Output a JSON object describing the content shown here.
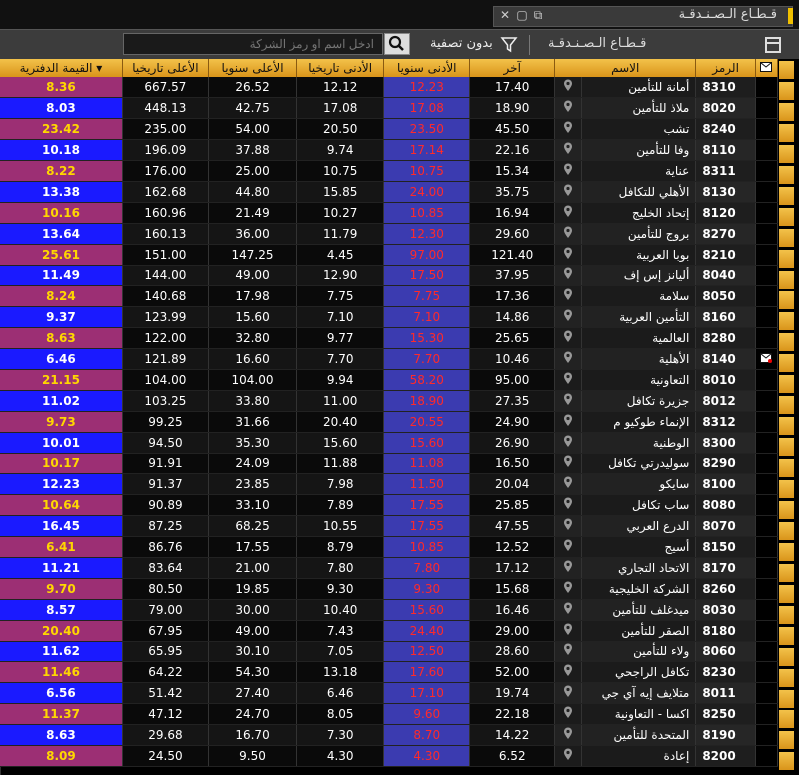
{
  "window": {
    "title": "قـطـاع الـصـنـدقـة"
  },
  "toolbar": {
    "sector_label": "قـطـاع الـصـنـدقـة",
    "filter_label": "بدون تصفية",
    "search_placeholder": "ادخل اسم او رمز الشركة"
  },
  "table": {
    "headers": {
      "symbol": "الرمز",
      "name": "الاسم",
      "last": "آخر",
      "low52": "الأدنى سنويا",
      "low_hist": "الأدنى تاريخيا",
      "high52": "الأعلى سنويا",
      "high_hist": "الأعلى تاريخيا",
      "book_value": "القيمة الدفترية"
    },
    "rows": [
      {
        "symbol": "8310",
        "name": "أمانة للتأمين",
        "last": "17.40",
        "low52": "12.23",
        "low_hist": "12.12",
        "high52": "26.52",
        "high_hist": "667.57",
        "bv": "8.36"
      },
      {
        "symbol": "8020",
        "name": "ملاذ للتأمين",
        "last": "18.90",
        "low52": "17.08",
        "low_hist": "17.08",
        "high52": "42.75",
        "high_hist": "448.13",
        "bv": "8.03"
      },
      {
        "symbol": "8240",
        "name": "تشب",
        "last": "45.50",
        "low52": "23.50",
        "low_hist": "20.50",
        "high52": "54.00",
        "high_hist": "235.00",
        "bv": "23.42"
      },
      {
        "symbol": "8110",
        "name": "وفا للتأمين",
        "last": "22.16",
        "low52": "17.14",
        "low_hist": "9.74",
        "high52": "37.88",
        "high_hist": "196.09",
        "bv": "10.18"
      },
      {
        "symbol": "8311",
        "name": "عناية",
        "last": "15.34",
        "low52": "10.75",
        "low_hist": "10.75",
        "high52": "25.00",
        "high_hist": "176.00",
        "bv": "8.22"
      },
      {
        "symbol": "8130",
        "name": "الأهلي للتكافل",
        "last": "35.75",
        "low52": "24.00",
        "low_hist": "15.85",
        "high52": "44.80",
        "high_hist": "162.68",
        "bv": "13.38"
      },
      {
        "symbol": "8120",
        "name": "إتحاد الخليج",
        "last": "16.94",
        "low52": "10.85",
        "low_hist": "10.27",
        "high52": "21.49",
        "high_hist": "160.96",
        "bv": "10.16"
      },
      {
        "symbol": "8270",
        "name": "بروج للتأمين",
        "last": "29.60",
        "low52": "12.30",
        "low_hist": "11.79",
        "high52": "36.00",
        "high_hist": "160.13",
        "bv": "13.64"
      },
      {
        "symbol": "8210",
        "name": "بوبا العربية",
        "last": "121.40",
        "low52": "97.00",
        "low_hist": "4.45",
        "high52": "147.25",
        "high_hist": "151.00",
        "bv": "25.61"
      },
      {
        "symbol": "8040",
        "name": "أليانز إس إف",
        "last": "37.95",
        "low52": "17.50",
        "low_hist": "12.90",
        "high52": "49.00",
        "high_hist": "144.00",
        "bv": "11.49"
      },
      {
        "symbol": "8050",
        "name": "سلامة",
        "last": "17.36",
        "low52": "7.75",
        "low_hist": "7.75",
        "high52": "17.98",
        "high_hist": "140.68",
        "bv": "8.24"
      },
      {
        "symbol": "8160",
        "name": "التأمين العربية",
        "last": "14.86",
        "low52": "7.10",
        "low_hist": "7.10",
        "high52": "15.60",
        "high_hist": "123.99",
        "bv": "9.37"
      },
      {
        "symbol": "8280",
        "name": "العالمية",
        "last": "25.65",
        "low52": "15.30",
        "low_hist": "9.77",
        "high52": "32.80",
        "high_hist": "122.00",
        "bv": "8.63"
      },
      {
        "symbol": "8140",
        "name": "الأهلية",
        "last": "10.46",
        "low52": "7.70",
        "low_hist": "7.70",
        "high52": "16.60",
        "high_hist": "121.89",
        "bv": "6.46"
      },
      {
        "symbol": "8010",
        "name": "التعاونية",
        "last": "95.00",
        "low52": "58.20",
        "low_hist": "9.94",
        "high52": "104.00",
        "high_hist": "104.00",
        "bv": "21.15"
      },
      {
        "symbol": "8012",
        "name": "جزيرة تكافل",
        "last": "27.35",
        "low52": "18.90",
        "low_hist": "11.00",
        "high52": "33.80",
        "high_hist": "103.25",
        "bv": "11.02"
      },
      {
        "symbol": "8312",
        "name": "الإنماء طوكيو م",
        "last": "24.90",
        "low52": "20.55",
        "low_hist": "20.40",
        "high52": "31.66",
        "high_hist": "99.25",
        "bv": "9.73"
      },
      {
        "symbol": "8300",
        "name": "الوطنية",
        "last": "26.90",
        "low52": "15.60",
        "low_hist": "15.60",
        "high52": "35.30",
        "high_hist": "94.50",
        "bv": "10.01"
      },
      {
        "symbol": "8290",
        "name": "سوليدرتي تكافل",
        "last": "16.50",
        "low52": "11.08",
        "low_hist": "11.88",
        "high52": "24.09",
        "high_hist": "91.91",
        "bv": "10.17"
      },
      {
        "symbol": "8100",
        "name": "سايكو",
        "last": "20.04",
        "low52": "11.50",
        "low_hist": "7.98",
        "high52": "23.85",
        "high_hist": "91.37",
        "bv": "12.23"
      },
      {
        "symbol": "8080",
        "name": "ساب تكافل",
        "last": "25.85",
        "low52": "17.55",
        "low_hist": "7.89",
        "high52": "33.10",
        "high_hist": "90.89",
        "bv": "10.64"
      },
      {
        "symbol": "8070",
        "name": "الدرع العربي",
        "last": "47.55",
        "low52": "17.55",
        "low_hist": "10.55",
        "high52": "68.25",
        "high_hist": "87.25",
        "bv": "16.45"
      },
      {
        "symbol": "8150",
        "name": "أسيج",
        "last": "12.52",
        "low52": "10.85",
        "low_hist": "8.79",
        "high52": "17.55",
        "high_hist": "86.76",
        "bv": "6.41"
      },
      {
        "symbol": "8170",
        "name": "الاتحاد التجاري",
        "last": "17.12",
        "low52": "7.80",
        "low_hist": "7.80",
        "high52": "21.00",
        "high_hist": "83.64",
        "bv": "11.21"
      },
      {
        "symbol": "8260",
        "name": "الشركة الخليجية",
        "last": "15.68",
        "low52": "9.30",
        "low_hist": "9.30",
        "high52": "19.85",
        "high_hist": "80.50",
        "bv": "9.70"
      },
      {
        "symbol": "8030",
        "name": "ميدغلف للتأمين",
        "last": "16.46",
        "low52": "15.60",
        "low_hist": "10.40",
        "high52": "30.00",
        "high_hist": "79.00",
        "bv": "8.57"
      },
      {
        "symbol": "8180",
        "name": "الصقر للتأمين",
        "last": "29.00",
        "low52": "24.40",
        "low_hist": "7.43",
        "high52": "49.00",
        "high_hist": "67.95",
        "bv": "20.40"
      },
      {
        "symbol": "8060",
        "name": "ولاء للتأمين",
        "last": "28.60",
        "low52": "12.50",
        "low_hist": "7.05",
        "high52": "30.10",
        "high_hist": "65.95",
        "bv": "11.62"
      },
      {
        "symbol": "8230",
        "name": "تكافل الراجحي",
        "last": "52.00",
        "low52": "17.60",
        "low_hist": "13.18",
        "high52": "54.30",
        "high_hist": "64.22",
        "bv": "11.46"
      },
      {
        "symbol": "8011",
        "name": "متلايف إيه آي جي",
        "last": "19.74",
        "low52": "17.10",
        "low_hist": "6.46",
        "high52": "27.40",
        "high_hist": "51.42",
        "bv": "6.56"
      },
      {
        "symbol": "8250",
        "name": "اكسا - التعاونية",
        "last": "22.18",
        "low52": "9.60",
        "low_hist": "8.05",
        "high52": "24.70",
        "high_hist": "47.12",
        "bv": "11.37"
      },
      {
        "symbol": "8190",
        "name": "المتحدة للتأمين",
        "last": "14.22",
        "low52": "8.70",
        "low_hist": "7.30",
        "high52": "16.70",
        "high_hist": "29.68",
        "bv": "8.63"
      },
      {
        "symbol": "8200",
        "name": "إعادة",
        "last": "6.52",
        "low52": "4.30",
        "low_hist": "4.30",
        "high52": "9.50",
        "high_hist": "24.50",
        "bv": "8.09"
      }
    ]
  }
}
